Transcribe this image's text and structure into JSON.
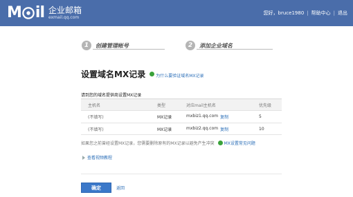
{
  "header": {
    "logo_text_left": "M",
    "logo_text_right": "il",
    "logo_cn_title": "企业邮箱",
    "logo_cn_sub": "exmail.qq.com",
    "greeting": "您好，bruce1980",
    "separator": "|",
    "help_center": "帮助中心",
    "logout": "退出",
    "bg_color": "#4a6daa"
  },
  "steps": [
    {
      "num": "1",
      "label": "创建管理帐号"
    },
    {
      "num": "2",
      "label": "添加企业域名"
    }
  ],
  "page": {
    "title": "设置域名MX记录",
    "help_link": "为什么要验证域名MX记录"
  },
  "table": {
    "intro": "请到您的域名提供商设置MX记录",
    "headers": [
      "主机名",
      "类型",
      "对应mail主机名",
      "优先级"
    ],
    "rows": [
      {
        "host": "(不填写)",
        "type": "MX记录",
        "mail_host": "mxbiz1.qq.com",
        "copy": "复制",
        "priority": "5"
      },
      {
        "host": "(不填写)",
        "type": "MX记录",
        "mail_host": "mxbiz2.qq.com",
        "copy": "复制",
        "priority": "10"
      }
    ]
  },
  "note": {
    "text": "如果您之前曾经设置MX记录，您需要删除原有的MX记录以避免产生冲突",
    "link": "MX设置常见问题"
  },
  "video_link": "查看视频教程",
  "actions": {
    "ok": "确定",
    "back": "返回"
  }
}
